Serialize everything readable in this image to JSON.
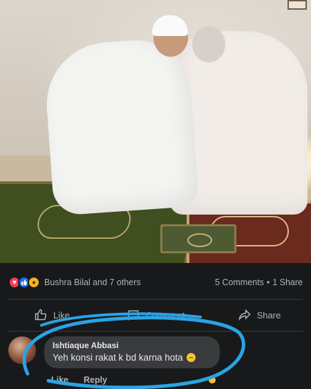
{
  "post": {
    "reactions": {
      "icons": [
        "love-icon",
        "like-icon",
        "care-icon"
      ],
      "names": "Bushra Bilal and 7 others",
      "comments": "5 Comments",
      "separator": "•",
      "shares": "1 Share"
    },
    "actions": {
      "like": "Like",
      "comment": "Comment",
      "share": "Share"
    }
  },
  "comment": {
    "author": "Ishtiaque Abbasi",
    "text": "Yeh konsi rakat k bd karna hota",
    "emoji": "upside-down-face-icon",
    "like": "Like",
    "reply": "Reply"
  },
  "colors": {
    "background": "#18191a",
    "bubble": "#3a3b3c",
    "text": "#e4e6eb",
    "muted": "#b0b3b8",
    "annotation": "#2aa3e6"
  }
}
